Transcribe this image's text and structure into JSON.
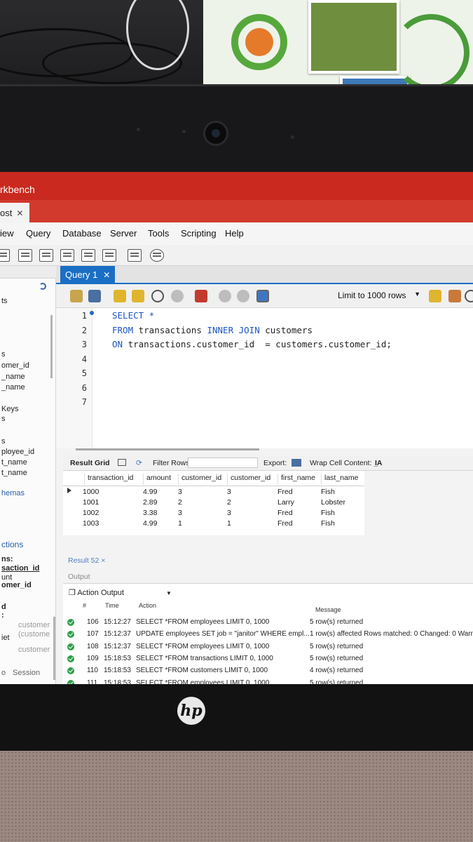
{
  "app": {
    "title": "rkbench",
    "connection_tab": "ost"
  },
  "menu": {
    "items": [
      "iew",
      "Query",
      "Database",
      "Server",
      "Tools",
      "Scripting",
      "Help"
    ]
  },
  "editor": {
    "tab_label": "Query 1",
    "limit_label": "Limit to 1000 rows",
    "lines": [
      {
        "num": "1",
        "code": [
          {
            "t": "SELECT *",
            "kw": true
          }
        ]
      },
      {
        "num": "2",
        "code": [
          {
            "t": "FROM",
            "kw": true
          },
          {
            "t": " transactions ",
            "kw": false
          },
          {
            "t": "INNER JOIN",
            "kw": true
          },
          {
            "t": " customers",
            "kw": false
          }
        ]
      },
      {
        "num": "3",
        "code": [
          {
            "t": "ON",
            "kw": true
          },
          {
            "t": " transactions.customer_id  = customers.customer_id;",
            "kw": false
          }
        ]
      },
      {
        "num": "4",
        "code": []
      },
      {
        "num": "5",
        "code": []
      },
      {
        "num": "6",
        "code": []
      },
      {
        "num": "7",
        "code": []
      }
    ]
  },
  "sidebar": {
    "items": [
      "ts",
      "s",
      "omer_id",
      "_name",
      "_name",
      "Keys",
      "s",
      "s",
      "ployee_id",
      "t_name",
      "t_name",
      "hemas",
      "ctions",
      "ns:",
      "saction_id",
      "unt",
      "omer_id",
      "d",
      ":",
      "customer",
      "(custome",
      "iet",
      "customer",
      "o",
      "Session"
    ]
  },
  "result_grid": {
    "label": "Result Grid",
    "filter_label": "Filter Rows:",
    "export_label": "Export:",
    "wrap_label": "Wrap Cell Content:",
    "columns": [
      "transaction_id",
      "amount",
      "customer_id",
      "customer_id",
      "first_name",
      "last_name"
    ],
    "rows": [
      [
        "1000",
        "4.99",
        "3",
        "3",
        "Fred",
        "Fish"
      ],
      [
        "1001",
        "2.89",
        "2",
        "2",
        "Larry",
        "Lobster"
      ],
      [
        "1002",
        "3.38",
        "3",
        "3",
        "Fred",
        "Fish"
      ],
      [
        "1003",
        "4.99",
        "1",
        "1",
        "Fred",
        "Fish"
      ]
    ]
  },
  "result_tab": "Result 52 ×",
  "output": {
    "label": "Output",
    "mode": "Action Output",
    "headers": {
      "num": "#",
      "time": "Time",
      "action": "Action",
      "message": "Message"
    },
    "rows": [
      {
        "num": "106",
        "time": "15:12:27",
        "action": "SELECT *FROM employees LIMIT 0, 1000",
        "message": "5 row(s) returned"
      },
      {
        "num": "107",
        "time": "15:12:37",
        "action": "UPDATE employees SET job = \"janitor\"  WHERE empl...",
        "message": "1 row(s) affected Rows matched: 0  Changed: 0  Warn"
      },
      {
        "num": "108",
        "time": "15:12:37",
        "action": "SELECT *FROM employees LIMIT 0, 1000",
        "message": "5 row(s) returned"
      },
      {
        "num": "109",
        "time": "15:18:53",
        "action": "SELECT *FROM transactions LIMIT 0, 1000",
        "message": "5 row(s) returned"
      },
      {
        "num": "110",
        "time": "15:18:53",
        "action": "SELECT *FROM customers LIMIT 0, 1000",
        "message": "4 row(s) returned"
      },
      {
        "num": "111",
        "time": "15:18:53",
        "action": "SELECT *FROM employees LIMIT 0, 1000",
        "message": "5 row(s) returned"
      }
    ]
  },
  "device": {
    "logo": "hp"
  },
  "colors": {
    "titlebar": "#c9291e",
    "accent": "#1a6fc4",
    "keyword": "#1d55c0",
    "ok": "#2e9e49"
  }
}
